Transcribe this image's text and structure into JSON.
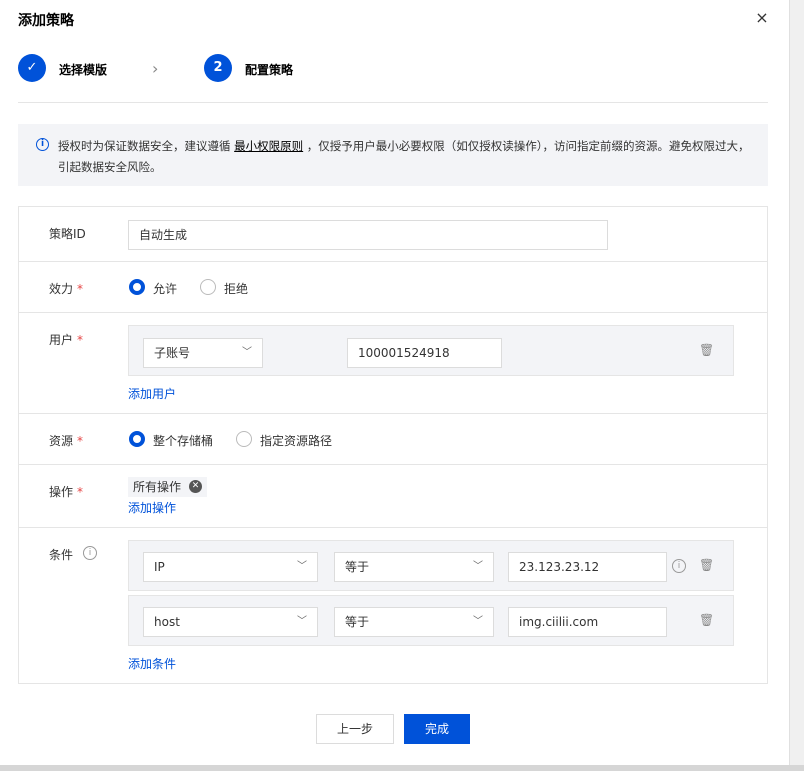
{
  "dialog": {
    "title": "添加策略",
    "close": "×"
  },
  "steps": [
    {
      "index": "✓",
      "label": "选择模版",
      "status": "done"
    },
    {
      "index": "2",
      "label": "配置策略",
      "status": "active"
    }
  ],
  "notice": {
    "icon": "info-icon",
    "text_before": "授权时为保证数据安全，建议遵循 ",
    "link": "最小权限原则",
    "text_after": " ，仅授予用户最小必要权限（如仅授权读操作），访问指定前缀的资源。避免权限过大，引起数据安全风险。"
  },
  "form": {
    "policy_id": {
      "label": "策略ID",
      "value": "自动生成"
    },
    "effect": {
      "label": "效力",
      "required": "*",
      "options": [
        "允许",
        "拒绝"
      ],
      "selected": "允许"
    },
    "user": {
      "label": "用户",
      "required": "*",
      "type": "子账号",
      "value": "100001524918",
      "add": "添加用户"
    },
    "resource": {
      "label": "资源",
      "required": "*",
      "options": [
        "整个存储桶",
        "指定资源路径"
      ],
      "selected": "整个存储桶"
    },
    "action": {
      "label": "操作",
      "required": "*",
      "tag": "所有操作",
      "add": "添加操作"
    },
    "condition": {
      "label": "条件",
      "rows": [
        {
          "key": "IP",
          "op": "等于",
          "value": "23.123.23.12"
        },
        {
          "key": "host",
          "op": "等于",
          "value": "img.ciilii.com"
        }
      ],
      "add": "添加条件"
    }
  },
  "footer": {
    "prev": "上一步",
    "done": "完成"
  },
  "colors": {
    "primary": "#0052d9",
    "required": "#e54545",
    "panel_bg": "#f3f4f7"
  }
}
